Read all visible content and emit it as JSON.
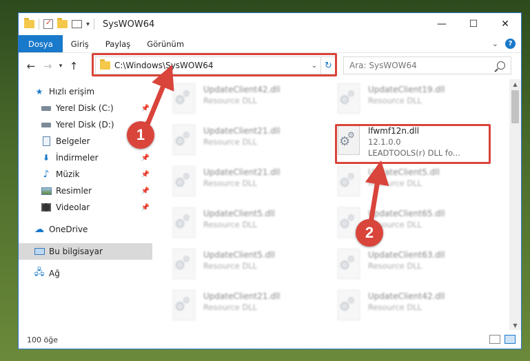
{
  "window": {
    "title": "SysWOW64",
    "minimize": "—",
    "maximize": "☐",
    "close": "✕"
  },
  "ribbon": {
    "tabs": [
      "Dosya",
      "Giriş",
      "Paylaş",
      "Görünüm"
    ],
    "help": "?"
  },
  "address": {
    "path": "C:\\Windows\\SysWOW64",
    "search_placeholder": "Ara: SysWOW64"
  },
  "nav": [
    {
      "label": "Hızlı erişim",
      "icon": "star-icon",
      "pinned": false
    },
    {
      "label": "Yerel Disk (C:)",
      "icon": "drive-icon",
      "pinned": true
    },
    {
      "label": "Yerel Disk (D:)",
      "icon": "drive-icon",
      "pinned": true
    },
    {
      "label": "Belgeler",
      "icon": "documents-icon",
      "pinned": true
    },
    {
      "label": "İndirmeler",
      "icon": "download-icon",
      "pinned": true
    },
    {
      "label": "Müzik",
      "icon": "music-icon",
      "pinned": true
    },
    {
      "label": "Resimler",
      "icon": "pictures-icon",
      "pinned": true
    },
    {
      "label": "Videolar",
      "icon": "videos-icon",
      "pinned": true
    },
    {
      "label": "OneDrive",
      "icon": "cloud-icon",
      "pinned": false
    },
    {
      "label": "Bu bilgisayar",
      "icon": "computer-icon",
      "pinned": false,
      "selected": true
    },
    {
      "label": "Ağ",
      "icon": "network-icon",
      "pinned": false
    }
  ],
  "files": [
    {
      "name": "UpdateClient42.dll",
      "sub": "Resource DLL",
      "blurred": true
    },
    {
      "name": "UpdateClient19.dll",
      "sub": "Resource DLL",
      "blurred": true
    },
    {
      "name": "UpdateClient21.dll",
      "sub": "Resource DLL",
      "blurred": true
    },
    {
      "name": "lfwmf12n.dll",
      "sub": "12.1.0.0",
      "sub2": "LEADTOOLS(r) DLL fo...",
      "blurred": false
    },
    {
      "name": "UpdateClient21.dll",
      "sub": "Resource DLL",
      "blurred": true
    },
    {
      "name": "UpdateClient5.dll",
      "sub": "Resource DLL",
      "blurred": true
    },
    {
      "name": "UpdateClient5.dll",
      "sub": "Resource DLL",
      "blurred": true
    },
    {
      "name": "UpdateClient65.dll",
      "sub": "Resource DLL",
      "blurred": true
    },
    {
      "name": "UpdateClient5.dll",
      "sub": "Resource DLL",
      "blurred": true
    },
    {
      "name": "UpdateClient63.dll",
      "sub": "Resource DLL",
      "blurred": true
    },
    {
      "name": "UpdateClient21.dll",
      "sub": "Resource DLL",
      "blurred": true
    },
    {
      "name": "UpdateClient42.dll",
      "sub": "Resource DLL",
      "blurred": true
    }
  ],
  "status": {
    "count": "100 öğe"
  },
  "annotations": {
    "step1": "1",
    "step2": "2",
    "color": "#d9443b"
  }
}
